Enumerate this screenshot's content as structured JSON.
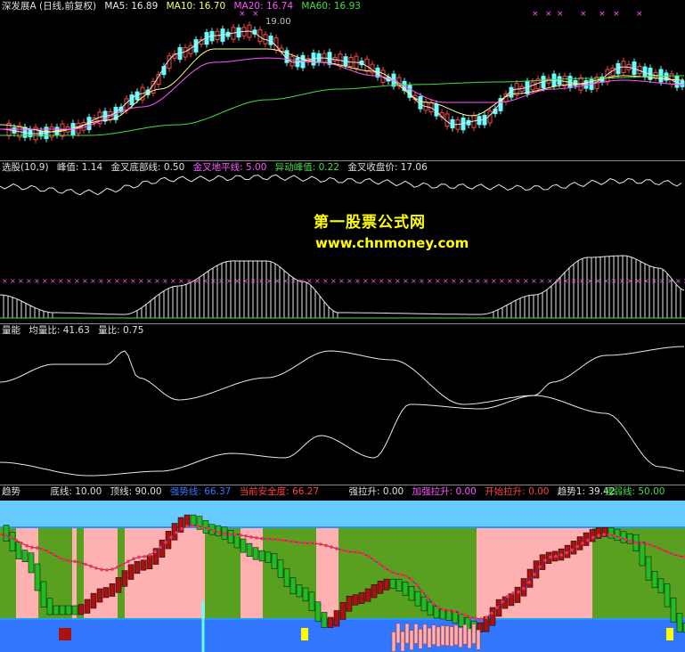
{
  "colors": {
    "white": "#e8e8e8",
    "yellow": "#ffff00",
    "magenta": "#ff44ff",
    "green": "#44dd44",
    "cyan": "#66ffff",
    "red": "#ff3333",
    "blue": "#3377ff",
    "pink": "#ffb0b0",
    "olive": "#5aa020"
  },
  "price": {
    "title": "深发展A (日线,前复权)",
    "ma5": "MA5: 16.89",
    "ma10": "MA10: 16.70",
    "ma20": "MA20: 16.74",
    "ma60": "MA60: 16.93",
    "peak_label": "19.00"
  },
  "xuangu": {
    "title": "选股(10,9)",
    "fengzhi": "峰值: 1.14",
    "jincha_dibu": "金叉底部线: 0.50",
    "jincha_dipingxian": "金叉地平线: 5.00",
    "yidong_fengzhi": "异动峰值: 0.22",
    "jincha_shoupanjia": "金叉收盘价: 17.06"
  },
  "watermark": {
    "line1": "第一股票公式网",
    "line2": "www.chnmoney.com"
  },
  "liangneng": {
    "title": "量能",
    "junliangbi": "均量比: 41.63",
    "liangbi": "量比: 0.75"
  },
  "qushi": {
    "title": "趋势",
    "dixian": "底线: 10.00",
    "dingxian": "顶线: 90.00",
    "ruishixian": "强势线: 66.37",
    "anquandu": "当前安全度: 66.27",
    "qianglasheng": "强拉升: 0.00",
    "jiaqianglasheng": "加强拉升: 0.00",
    "kaishilasheng": "开始拉升: 0.00",
    "qushi1": "趋势1: 39.42",
    "qiangruoxian": "强弱线: 50.00"
  }
}
